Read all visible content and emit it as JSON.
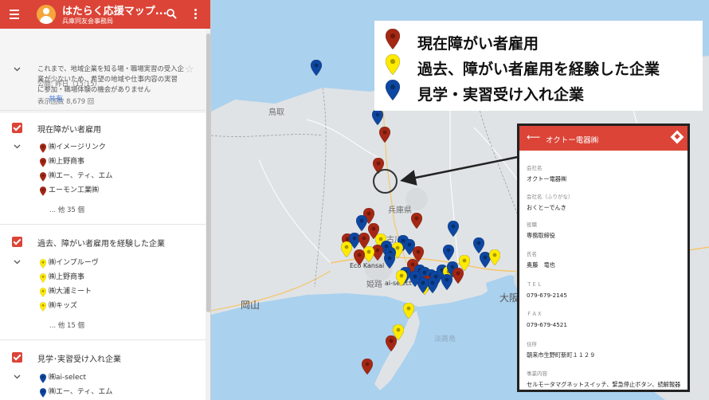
{
  "header": {
    "title": "はたらく応援マップ...",
    "subtitle": "兵庫同友会事務局"
  },
  "description": {
    "text": "これまで、地域企業を知る場・職場実習の受入企業が少ないため、希望の地域や仕事内容の実習に参加・職場体験の機会がありません",
    "views": "表示回数 8,679 回",
    "published": "公開: 昨日（15:15）",
    "share_label": "共有"
  },
  "layers": [
    {
      "label": "現在障がい者雇用",
      "color": "#a52714",
      "items": [
        "㈱イメージリンク",
        "㈱上野商事",
        "㈱エー、ティ、エム",
        "エーモン工業㈱"
      ],
      "more": "... 他 35 個"
    },
    {
      "label": "過去、障がい者雇用を経験した企業",
      "color": "#ffea00",
      "items": [
        "㈱インプルーヴ",
        "㈱上野商事",
        "㈱大浦ミート",
        "㈱キッズ"
      ],
      "more": "... 他 15 個"
    },
    {
      "label": "見学･実習受け入れ企業",
      "color": "#0d47a1",
      "items": [
        "㈱ai-select",
        "㈱エー、ティ、エム"
      ]
    }
  ],
  "legend": [
    {
      "label": "現在障がい者雇用",
      "color": "#a52714"
    },
    {
      "label": "過去、障がい者雇用を経験した企業",
      "color": "#ffea00"
    },
    {
      "label": "見学・実習受け入れ企業",
      "color": "#0d47a1"
    }
  ],
  "card": {
    "title": "オクトー電器㈱",
    "fields": [
      {
        "key": "会社名",
        "value": "オクトー電器㈱"
      },
      {
        "key": "会社名（ふりがな）",
        "value": "おくとーでんき"
      },
      {
        "key": "役職",
        "value": "専務取締役"
      },
      {
        "key": "氏名",
        "value": "奥藤　竜也"
      },
      {
        "key": "ＴＥＬ",
        "value": "079-679-2145"
      },
      {
        "key": "ＦＡＸ",
        "value": "079-679-4521"
      },
      {
        "key": "住所",
        "value": "朝来市生野町新町１１２９"
      },
      {
        "key": "事業内容",
        "value": "セルモータマグネットスイッチ、緊急停止ボタン、続解報器"
      }
    ]
  },
  "map": {
    "places": [
      "鳥取",
      "兵庫県",
      "岡山",
      "大阪",
      "加古川",
      "姫路",
      "淡路島"
    ],
    "poi_labels": [
      "Eco Kansai",
      "ai-select"
    ]
  }
}
